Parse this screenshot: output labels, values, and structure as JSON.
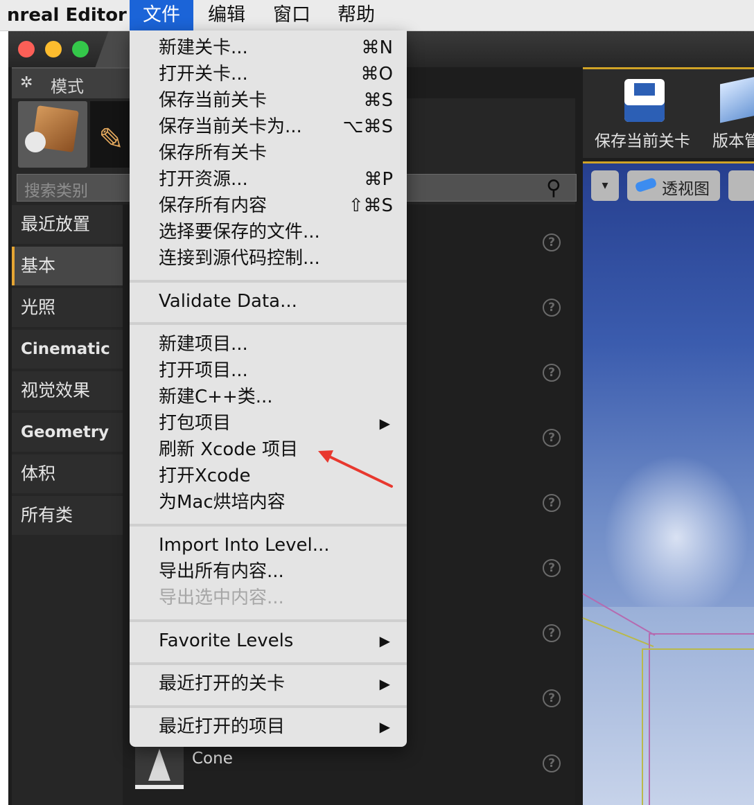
{
  "menubar": {
    "app_title": "nreal Editor",
    "items": [
      "文件",
      "编辑",
      "窗口",
      "帮助"
    ]
  },
  "modes_panel": {
    "tab_label": "模式",
    "search_placeholder": "搜索类别",
    "categories": [
      "最近放置",
      "基本",
      "光照",
      "Cinematic",
      "视觉效果",
      "Geometry",
      "体积",
      "所有类"
    ],
    "selected_category": "基本",
    "visible_item": "Cone",
    "help_glyph": "?"
  },
  "toolbar": {
    "save_label": "保存当前关卡",
    "version_label": "版本管"
  },
  "viewport": {
    "perspective_label": "透视图",
    "dropdown_glyph": "▾"
  },
  "file_menu": {
    "group1": [
      {
        "label": "新建关卡...",
        "shortcut": "⌘N"
      },
      {
        "label": "打开关卡...",
        "shortcut": "⌘O"
      },
      {
        "label": "保存当前关卡",
        "shortcut": "⌘S"
      },
      {
        "label": "保存当前关卡为...",
        "shortcut": "⌥⌘S"
      },
      {
        "label": "保存所有关卡",
        "shortcut": ""
      },
      {
        "label": "打开资源...",
        "shortcut": "⌘P"
      },
      {
        "label": "保存所有内容",
        "shortcut": "⇧⌘S"
      },
      {
        "label": "选择要保存的文件...",
        "shortcut": ""
      },
      {
        "label": "连接到源代码控制...",
        "shortcut": ""
      }
    ],
    "group2": [
      {
        "label": "Validate Data..."
      }
    ],
    "group3": [
      {
        "label": "新建项目..."
      },
      {
        "label": "打开项目..."
      },
      {
        "label": "新建C++类..."
      },
      {
        "label": "打包项目",
        "submenu": true
      },
      {
        "label": "刷新 Xcode 项目"
      },
      {
        "label": "打开Xcode"
      },
      {
        "label": "为Mac烘培内容"
      }
    ],
    "group4": [
      {
        "label": "Import Into Level..."
      },
      {
        "label": "导出所有内容..."
      },
      {
        "label": "导出选中内容...",
        "disabled": true
      }
    ],
    "group5": [
      {
        "label": "Favorite Levels",
        "submenu": true
      }
    ],
    "group6": [
      {
        "label": "最近打开的关卡",
        "submenu": true
      }
    ],
    "group7": [
      {
        "label": "最近打开的项目",
        "submenu": true
      }
    ],
    "submenu_glyph": "▶"
  },
  "colors": {
    "menu_highlight": "#1b64d8",
    "annotation_arrow": "#e8382e",
    "selected_accent": "#e5a533"
  }
}
